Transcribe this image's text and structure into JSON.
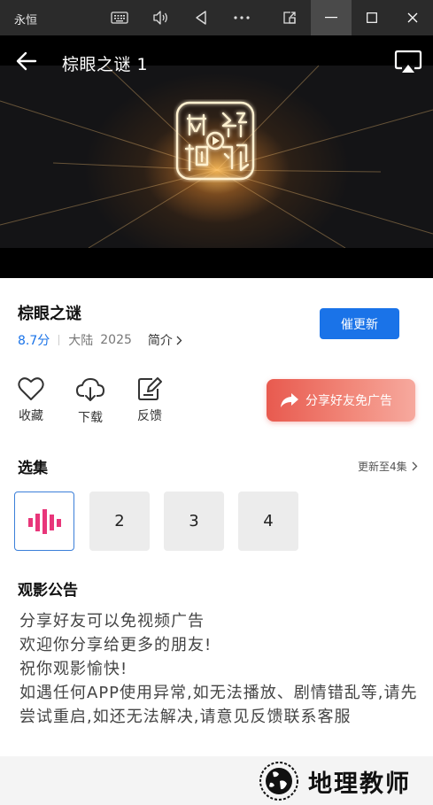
{
  "window": {
    "app_title": "永恒",
    "controls": [
      "keyboard-icon",
      "volume-icon",
      "back-triangle-icon",
      "more-icon",
      "pip-icon",
      "minimize-icon",
      "maximize-icon",
      "close-icon"
    ]
  },
  "player": {
    "title": "棕眼之谜 1",
    "logo_text": "网络视听"
  },
  "show": {
    "name": "棕眼之谜",
    "score": "8.7分",
    "region": "大陆",
    "year": "2025",
    "intro_label": "简介",
    "update_button": "催更新"
  },
  "actions": {
    "favorite": "收藏",
    "download": "下载",
    "feedback": "反馈",
    "share_banner": "分享好友免广告"
  },
  "episodes": {
    "title": "选集",
    "more": "更新至4集",
    "items": [
      "",
      "2",
      "3",
      "4"
    ],
    "current_index": 0
  },
  "notice": {
    "title": "观影公告",
    "lines": [
      "分享好友可以免视频广告",
      "欢迎你分享给更多的朋友!",
      "祝你观影愉快!",
      "如遇任何APP使用异常,如无法播放、剧情错乱等,请先尝试重启,如还无法解决,请意见反馈联系客服"
    ]
  },
  "watermark": {
    "text": "地理教师"
  },
  "colors": {
    "accent": "#1a73e8",
    "share_banner": "#e85a4f",
    "playing_bars": "#e8367a"
  }
}
